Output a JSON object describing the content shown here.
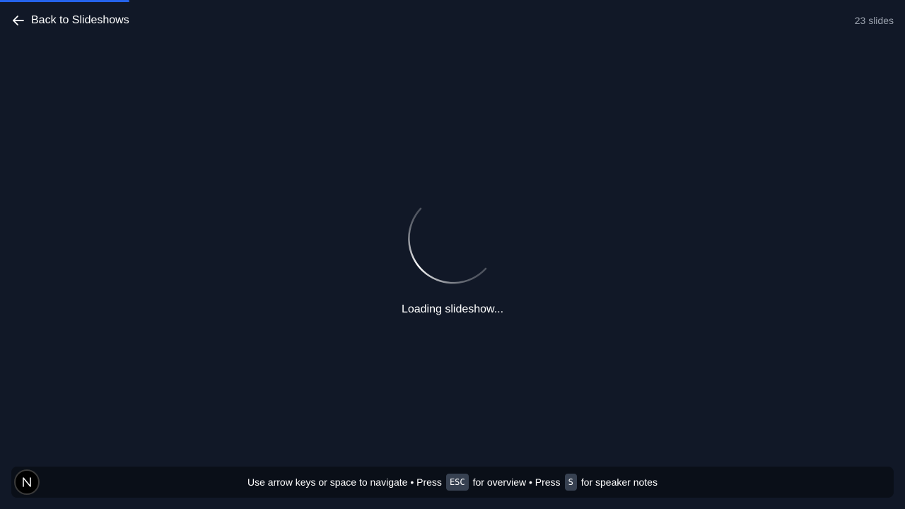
{
  "header": {
    "back_label": "Back to Slideshows",
    "back_icon": "arrow-left-icon",
    "slide_count": "23 slides"
  },
  "progress": {
    "fraction": 0.143,
    "color": "#2563eb"
  },
  "loader": {
    "text": "Loading slideshow...",
    "icon": "spinner-icon"
  },
  "footer": {
    "badge_letter": "N",
    "hint_part1": "Use arrow keys or space to navigate • Press",
    "key_overview": "ESC",
    "hint_part2": "for overview • Press",
    "key_notes": "S",
    "hint_part3": "for speaker notes"
  },
  "colors": {
    "background": "#111827",
    "footer_background": "#0a0f18",
    "kbd_background": "#374151",
    "muted_text": "#9ca3af"
  }
}
